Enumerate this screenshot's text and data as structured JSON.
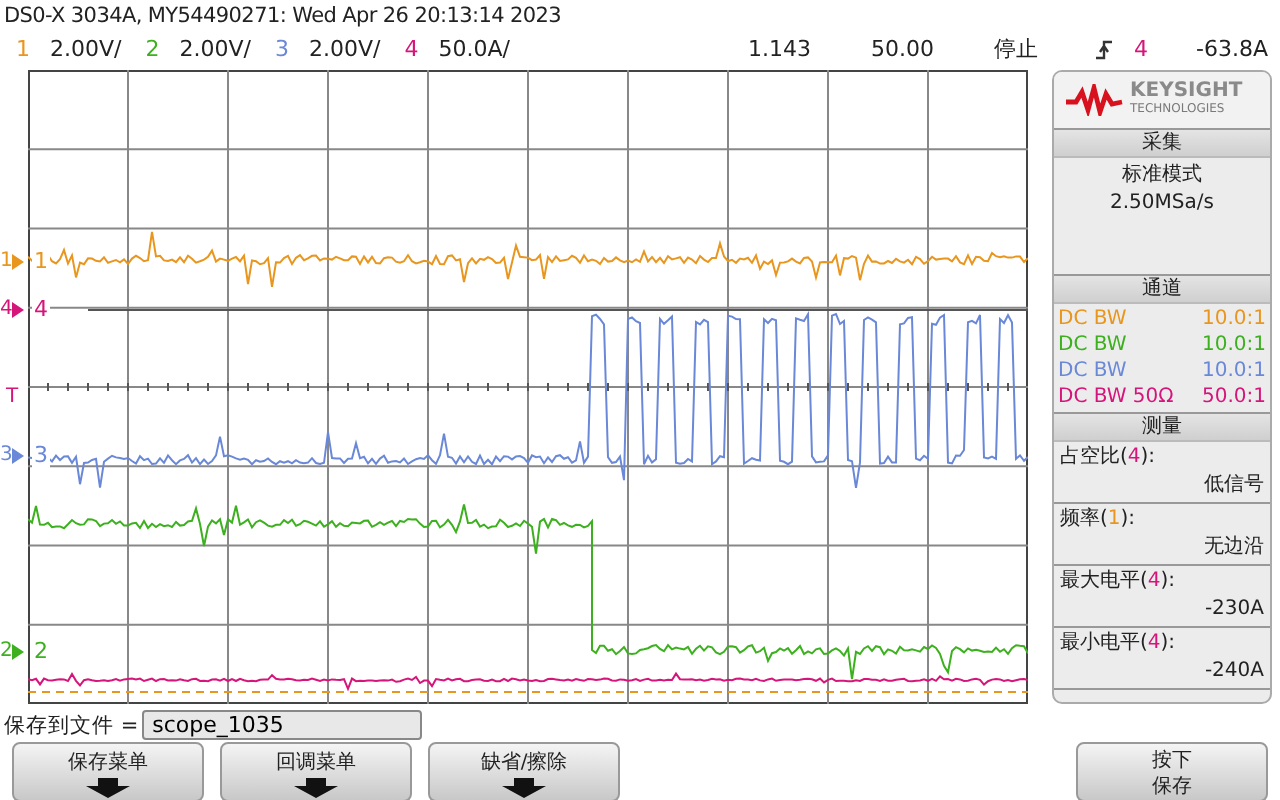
{
  "title": "DS0-X 3034A, MY54490271: Wed Apr 26 20:13:14 2023",
  "channels": [
    {
      "number": "1",
      "scale": "2.00V/",
      "color": "#e8961e"
    },
    {
      "number": "2",
      "scale": "2.00V/",
      "color": "#3cb01e"
    },
    {
      "number": "3",
      "scale": "2.00V/",
      "color": "#6a88d8"
    },
    {
      "number": "4",
      "scale": "50.0A/",
      "color": "#d6157a"
    }
  ],
  "markers": [
    {
      "label": "1",
      "trace_label": "1",
      "color": "#e8961e"
    },
    {
      "label": "4",
      "trace_label": "4",
      "color": "#d6157a"
    },
    {
      "label": "3",
      "trace_label": "3",
      "color": "#6a88d8"
    },
    {
      "label": "2",
      "trace_label": "2",
      "color": "#3cb01e"
    }
  ],
  "time_delay": "1.143",
  "time_scale": "50.00",
  "run_state": "停止",
  "trigger": {
    "source": "4",
    "color": "#d6157a",
    "level": "-63.8A",
    "marker": "T"
  },
  "panel": {
    "logo": {
      "name": "KEYSIGHT",
      "sub": "TECHNOLOGIES"
    },
    "acquisition": {
      "title": "采集",
      "mode": "标准模式",
      "rate": "2.50MSa/s"
    },
    "channel_section": {
      "title": "通道",
      "rows": [
        {
          "coupling": "DC BW",
          "probe": "10.0:1",
          "color": "#e8961e"
        },
        {
          "coupling": "DC BW",
          "probe": "10.0:1",
          "color": "#3cb01e"
        },
        {
          "coupling": "DC BW",
          "probe": "10.0:1",
          "color": "#6a88d8"
        },
        {
          "coupling": "DC BW 50Ω",
          "probe": "50.0:1",
          "color": "#d6157a"
        }
      ]
    },
    "measure_section": {
      "title": "测量",
      "items": [
        {
          "prefix": "占空比(",
          "source": "4",
          "suffix": "):",
          "color": "#d6157a",
          "value": "低信号"
        },
        {
          "prefix": "频率(",
          "source": "1",
          "suffix": "):",
          "color": "#e8961e",
          "value": "无边沿"
        },
        {
          "prefix": "最大电平(",
          "source": "4",
          "suffix": "):",
          "color": "#d6157a",
          "value": "-230A"
        },
        {
          "prefix": "最小电平(",
          "source": "4",
          "suffix": "):",
          "color": "#d6157a",
          "value": "-240A"
        }
      ]
    }
  },
  "save": {
    "label": "保存到文件 =",
    "value": "scope_1035"
  },
  "softkeys": [
    {
      "kind": "menu",
      "lines": [
        "保存菜单"
      ]
    },
    {
      "kind": "menu",
      "lines": [
        "回调菜单"
      ]
    },
    {
      "kind": "menu",
      "lines": [
        "缺省/擦除"
      ]
    },
    {
      "kind": "action",
      "lines": [
        "按下",
        "保存"
      ]
    }
  ]
}
